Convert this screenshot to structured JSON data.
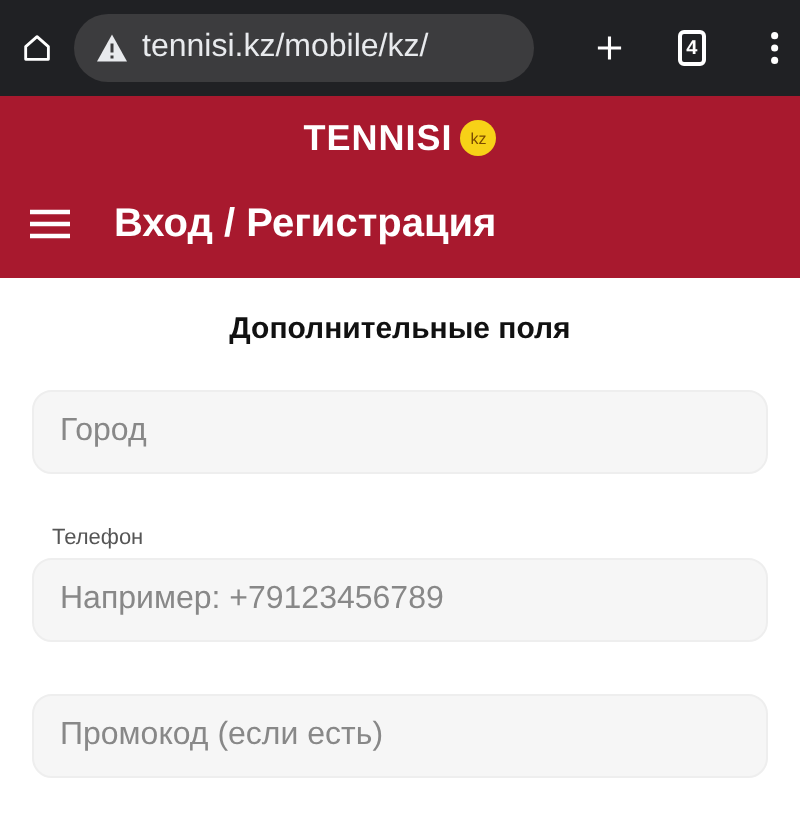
{
  "browser": {
    "url": "tennisi.kz/mobile/kz/",
    "tab_count": "4"
  },
  "header": {
    "logo": "TENNISI",
    "logo_badge": "kz",
    "title": "Вход / Регистрация"
  },
  "form": {
    "heading": "Дополнительные поля",
    "fields": [
      {
        "placeholder": "Город"
      },
      {
        "label": "Телефон",
        "placeholder": "Например: +79123456789"
      },
      {
        "placeholder": "Промокод (если есть)"
      }
    ]
  }
}
